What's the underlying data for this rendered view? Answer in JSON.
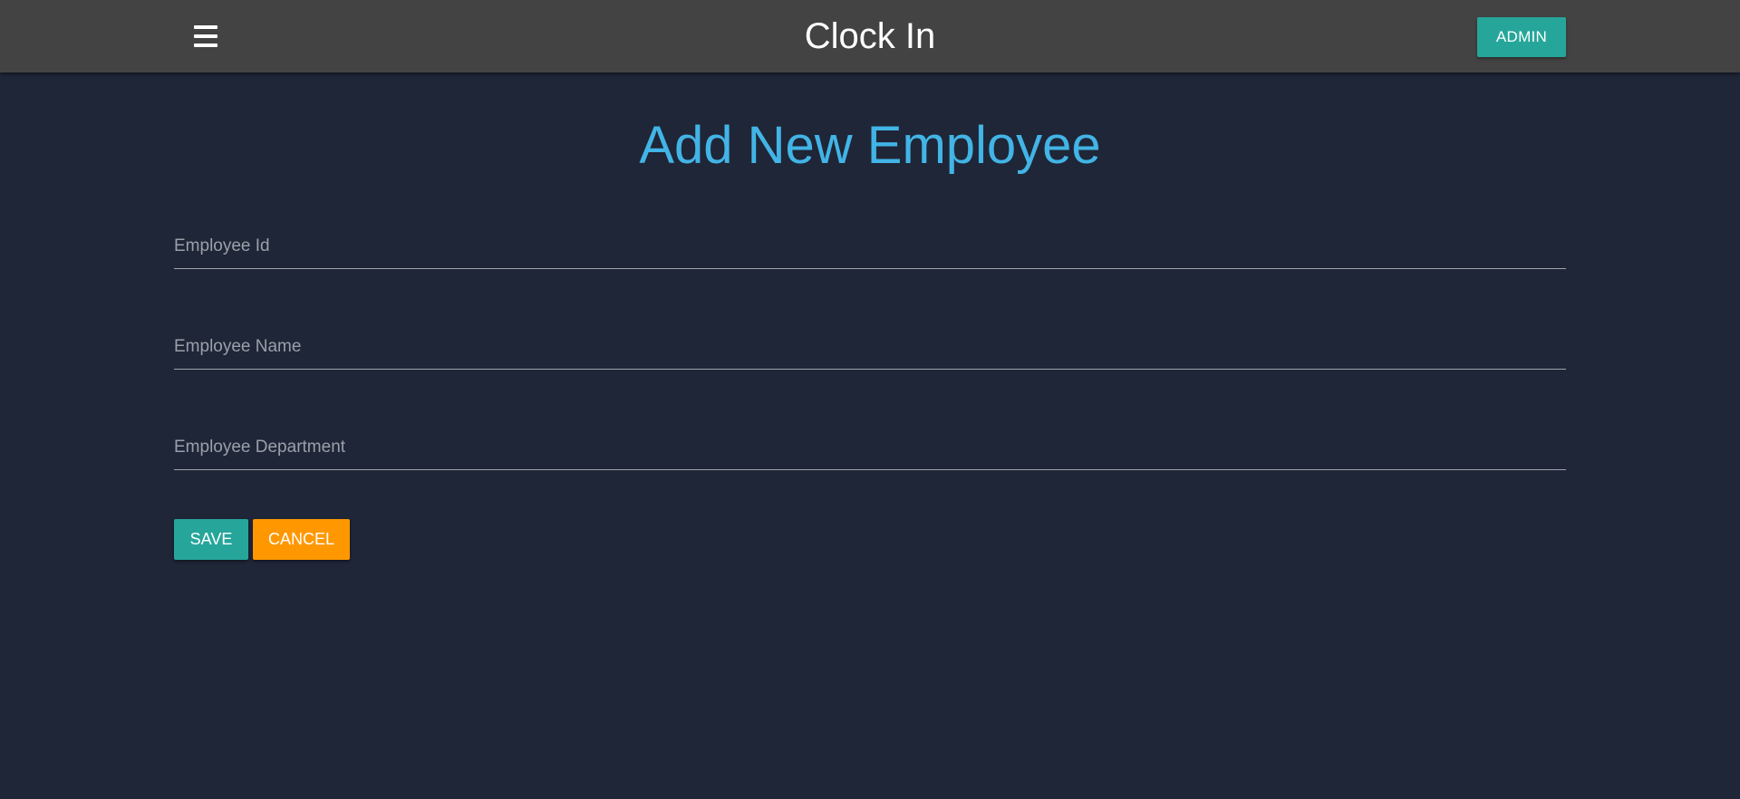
{
  "header": {
    "title": "Clock In",
    "menu_icon": "hamburger-menu-icon",
    "admin_label": "ADMIN",
    "admin_color": "#26a69a",
    "bar_color": "#434343"
  },
  "main": {
    "heading": "Add New Employee",
    "heading_color": "#42b4e6",
    "fields": [
      {
        "placeholder": "Employee Id",
        "value": ""
      },
      {
        "placeholder": "Employee Name",
        "value": ""
      },
      {
        "placeholder": "Employee Department",
        "value": ""
      }
    ],
    "save_label": "SAVE",
    "save_color": "#26a69a",
    "cancel_label": "CANCEL",
    "cancel_color": "#ff9800"
  }
}
